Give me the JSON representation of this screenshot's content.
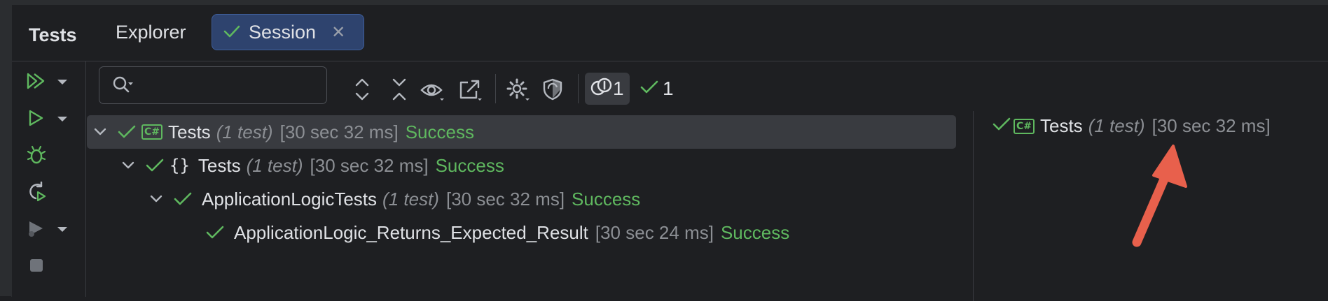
{
  "tabs": {
    "title": "Tests",
    "explorer": "Explorer",
    "session": "Session"
  },
  "search": {
    "value": "",
    "placeholder": ""
  },
  "toolbar": {
    "running_count": "1",
    "passed_count": "1"
  },
  "tree": [
    {
      "name": "Tests",
      "count": "(1 test)",
      "duration": "[30 sec 32 ms]",
      "status": "Success",
      "icon": "csharp-project-icon"
    },
    {
      "name": "Tests",
      "count": "(1 test)",
      "duration": "[30 sec 32 ms]",
      "status": "Success",
      "icon": "namespace-braces-icon"
    },
    {
      "name": "ApplicationLogicTests",
      "count": "(1 test)",
      "duration": "[30 sec 32 ms]",
      "status": "Success",
      "icon": "none"
    },
    {
      "name": "ApplicationLogic_Returns_Expected_Result",
      "count": "",
      "duration": "[30 sec 24 ms]",
      "status": "Success",
      "icon": "none"
    }
  ],
  "badge": {
    "text": "C#"
  },
  "detail": {
    "name": "Tests",
    "count": "(1 test)",
    "duration": "[30 sec 32 ms]"
  },
  "colors": {
    "background": "#1e1f22",
    "success": "#5fb85f",
    "muted": "#8c8f94",
    "session_tab": "#2e436e",
    "annotation_arrow": "#e8604c"
  }
}
